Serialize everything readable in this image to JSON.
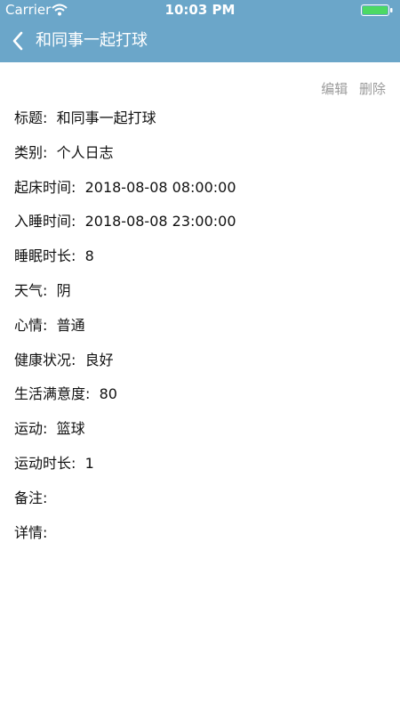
{
  "status_bar": {
    "carrier": "Carrier",
    "time": "10:03 PM",
    "wifi_icon": "wifi-icon",
    "battery_icon": "battery-icon",
    "battery_color": "#4cd964"
  },
  "nav": {
    "back_icon": "chevron-left-icon",
    "title": "和同事一起打球",
    "bar_color": "#6ba6c9"
  },
  "actions": {
    "edit_label": "编辑",
    "delete_label": "删除"
  },
  "fields": [
    {
      "label": "标题:",
      "value": "和同事一起打球"
    },
    {
      "label": "类别:",
      "value": "个人日志"
    },
    {
      "label": "起床时间:",
      "value": "2018-08-08 08:00:00"
    },
    {
      "label": "入睡时间:",
      "value": "2018-08-08 23:00:00"
    },
    {
      "label": "睡眠时长:",
      "value": "8"
    },
    {
      "label": "天气:",
      "value": "阴"
    },
    {
      "label": "心情:",
      "value": "普通"
    },
    {
      "label": "健康状况:",
      "value": "良好"
    },
    {
      "label": "生活满意度:",
      "value": "80"
    },
    {
      "label": "运动:",
      "value": "篮球"
    },
    {
      "label": "运动时长:",
      "value": "1"
    },
    {
      "label": "备注:",
      "value": ""
    },
    {
      "label": "详情:",
      "value": ""
    }
  ]
}
